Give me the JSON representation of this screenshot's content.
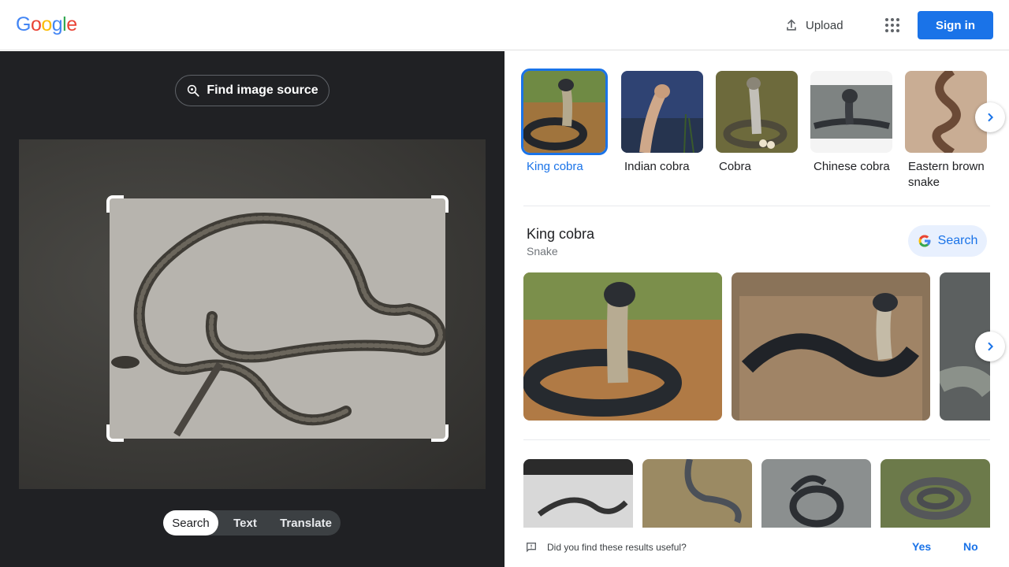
{
  "header": {
    "logo": [
      "G",
      "o",
      "o",
      "g",
      "l",
      "e"
    ],
    "logo_colors": [
      "#4285F4",
      "#EA4335",
      "#FBBC05",
      "#4285F4",
      "#34A853",
      "#EA4335"
    ],
    "upload_label": "Upload",
    "signin_label": "Sign in",
    "accent": "#1a73e8"
  },
  "left": {
    "find_source_label": "Find image source",
    "tabs": [
      {
        "label": "Search",
        "active": true
      },
      {
        "label": "Text",
        "active": false
      },
      {
        "label": "Translate",
        "active": false
      }
    ]
  },
  "right": {
    "related": [
      {
        "label": "King cobra",
        "selected": true
      },
      {
        "label": "Indian cobra",
        "selected": false
      },
      {
        "label": "Cobra",
        "selected": false
      },
      {
        "label": "Chinese cobra",
        "selected": false
      },
      {
        "label": "Eastern brown snake",
        "selected": false
      }
    ],
    "entity": {
      "title": "King cobra",
      "subtitle": "Snake",
      "search_label": "Search"
    },
    "feedback": {
      "question": "Did you find these results useful?",
      "yes": "Yes",
      "no": "No"
    }
  }
}
